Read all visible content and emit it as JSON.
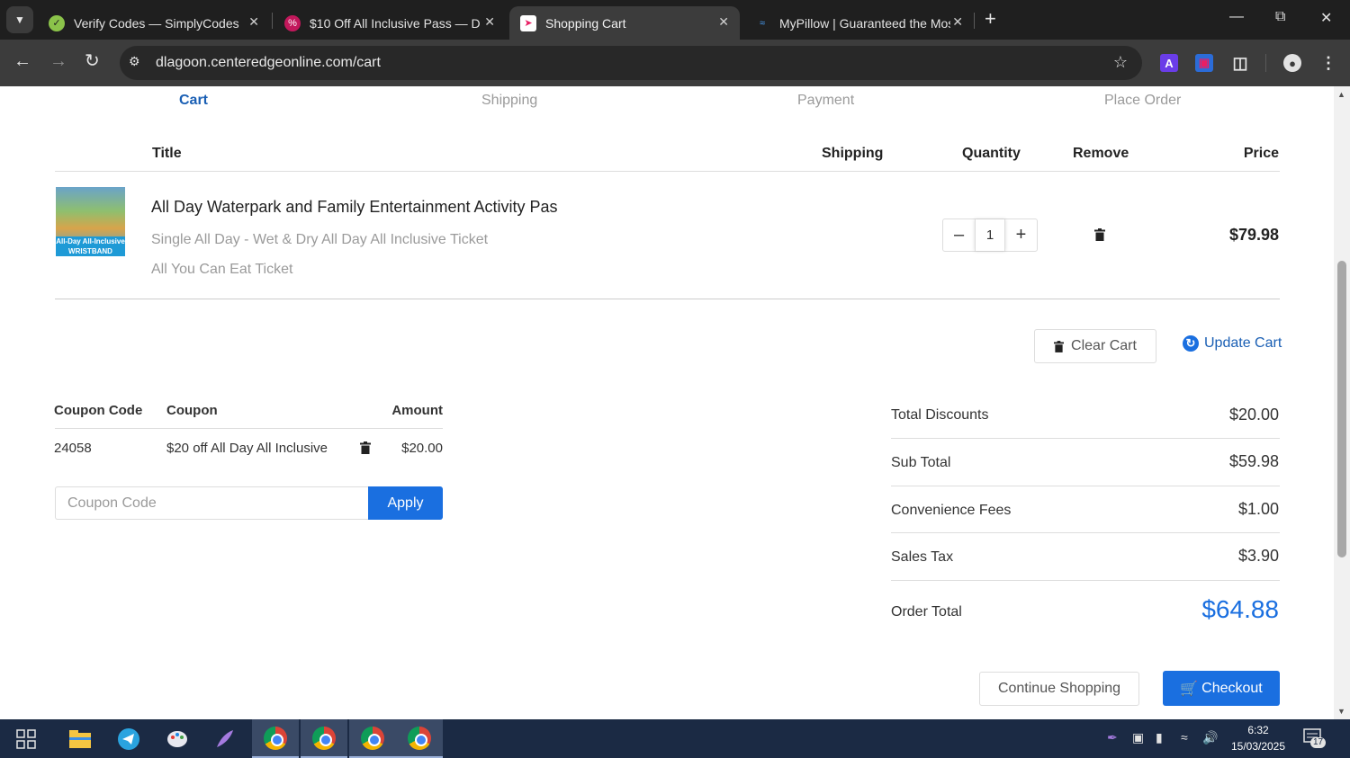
{
  "browser": {
    "tabs": [
      {
        "title": "Verify Codes — SimplyCodes",
        "active": false
      },
      {
        "title": "$10 Off All Inclusive Pass — Da",
        "active": false
      },
      {
        "title": "Shopping Cart",
        "active": true
      },
      {
        "title": "MyPillow | Guaranteed the Mos",
        "active": false
      }
    ],
    "url": "dlagoon.centeredgeonline.com/cart",
    "extension_label": "A"
  },
  "steps": [
    "Cart",
    "Shipping",
    "Payment",
    "Place Order"
  ],
  "cart": {
    "headers": {
      "title": "Title",
      "shipping": "Shipping",
      "quantity": "Quantity",
      "remove": "Remove",
      "price": "Price"
    },
    "item": {
      "title": "All Day Waterpark and Family Entertainment Activity Pas",
      "variant": "Single All Day - Wet & Dry All Day All Inclusive Ticket",
      "addon": "All You Can Eat Ticket",
      "thumbnail_text": "All-Day All-Inclusive WRISTBAND",
      "quantity": "1",
      "price": "$79.98"
    },
    "clear_label": "Clear Cart",
    "update_label": "Update Cart"
  },
  "coupons": {
    "headers": {
      "code": "Coupon Code",
      "coupon": "Coupon",
      "amount": "Amount"
    },
    "rows": [
      {
        "code": "24058",
        "coupon": "$20 off All Day All Inclusive",
        "amount": "$20.00"
      }
    ],
    "input_placeholder": "Coupon Code",
    "apply_label": "Apply"
  },
  "summary": {
    "rows": [
      {
        "label": "Total Discounts",
        "value": "$20.00"
      },
      {
        "label": "Sub Total",
        "value": "$59.98"
      },
      {
        "label": "Convenience Fees",
        "value": "$1.00"
      },
      {
        "label": "Sales Tax",
        "value": "$3.90"
      }
    ],
    "total_label": "Order Total",
    "total_value": "$64.88"
  },
  "actions": {
    "continue_label": "Continue Shopping",
    "checkout_label": "Checkout"
  },
  "taskbar": {
    "time": "6:32",
    "date": "15/03/2025",
    "notifications": "17"
  },
  "colors": {
    "accent": "#1a6fe0",
    "step_active": "#1a5fb4"
  }
}
